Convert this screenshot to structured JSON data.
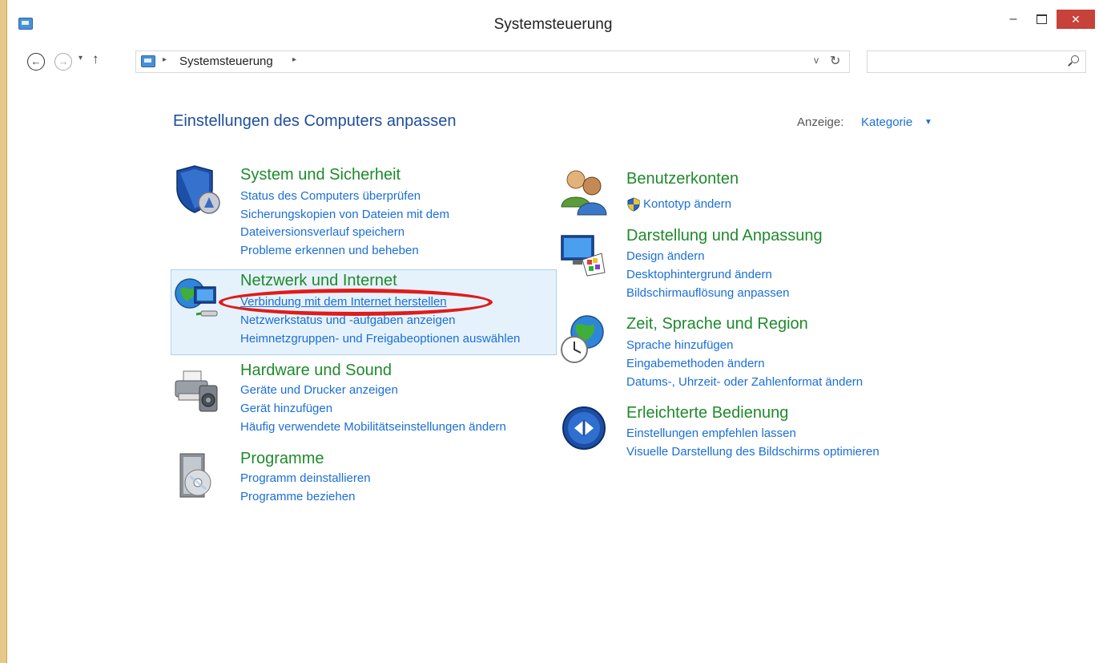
{
  "window": {
    "title": "Systemsteuerung",
    "controls": {
      "minimize": "–",
      "close": "✕"
    }
  },
  "navigation": {
    "back": "←",
    "forward": "→",
    "recent": "▾",
    "up": "↑",
    "address_separator": "▸",
    "address_path": "Systemsteuerung",
    "address_dropdown": "v",
    "refresh": "↻",
    "search_placeholder": ""
  },
  "header": {
    "title": "Einstellungen des Computers anpassen",
    "view_label": "Anzeige:",
    "view_value": "Kategorie",
    "view_caret": "▼"
  },
  "categories_left": [
    {
      "title": "System und Sicherheit",
      "icon": "shield-icon",
      "links": [
        "Status des Computers überprüfen",
        "Sicherungskopien von Dateien mit dem",
        "Dateiversionsverlauf speichern",
        "Probleme erkennen und beheben"
      ]
    },
    {
      "title": "Netzwerk und Internet",
      "icon": "network-globe-icon",
      "links": [
        "Verbindung mit dem Internet herstellen",
        "Netzwerkstatus und -aufgaben anzeigen",
        "Heimnetzgruppen- und Freigabeoptionen auswählen"
      ]
    },
    {
      "title": "Hardware und Sound",
      "icon": "printer-speaker-icon",
      "links": [
        "Geräte und Drucker anzeigen",
        "Gerät hinzufügen",
        "Häufig verwendete Mobilitätseinstellungen ändern"
      ]
    },
    {
      "title": "Programme",
      "icon": "programs-disc-icon",
      "links": [
        "Programm deinstallieren",
        "Programme beziehen"
      ]
    }
  ],
  "categories_right": [
    {
      "title": "Benutzerkonten",
      "icon": "users-icon",
      "links": [
        "Kontotyp ändern"
      ]
    },
    {
      "title": "Darstellung und Anpassung",
      "icon": "monitor-palette-icon",
      "links": [
        "Design ändern",
        "Desktophintergrund ändern",
        "Bildschirmauflösung anpassen"
      ]
    },
    {
      "title": "Zeit, Sprache und Region",
      "icon": "globe-clock-icon",
      "links": [
        "Sprache hinzufügen",
        "Eingabemethoden ändern",
        "Datums-, Uhrzeit- oder Zahlenformat ändern"
      ]
    },
    {
      "title": "Erleichterte Bedienung",
      "icon": "accessibility-icon",
      "links": [
        "Einstellungen empfehlen lassen",
        "Visuelle Darstellung des Bildschirms optimieren"
      ]
    }
  ]
}
